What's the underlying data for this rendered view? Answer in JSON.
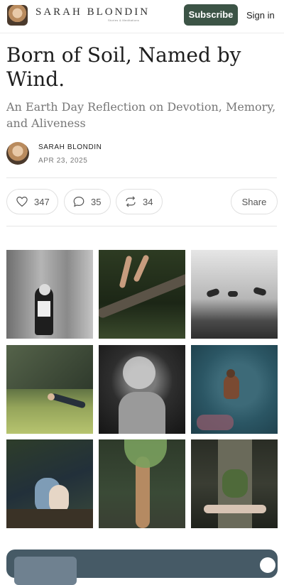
{
  "header": {
    "brand_name": "SARAH BLONDIN",
    "brand_tagline": "Stories & Meditations",
    "subscribe_label": "Subscribe",
    "signin_label": "Sign in"
  },
  "post": {
    "title": "Born of Soil, Named by Wind.",
    "subtitle": "An Earth Day Reflection on Devotion, Memory, and Aliveness",
    "author": "SARAH BLONDIN",
    "date": "APR 23, 2025"
  },
  "actions": {
    "likes": "347",
    "comments": "35",
    "restacks": "34",
    "share_label": "Share"
  },
  "icons": {
    "like": "heart-icon",
    "comment": "speech-bubble-icon",
    "restack": "repeat-arrows-icon",
    "embed": "spotify-icon"
  },
  "colors": {
    "subscribe_bg": "#3c5446",
    "embed_bg": "#465a66"
  }
}
